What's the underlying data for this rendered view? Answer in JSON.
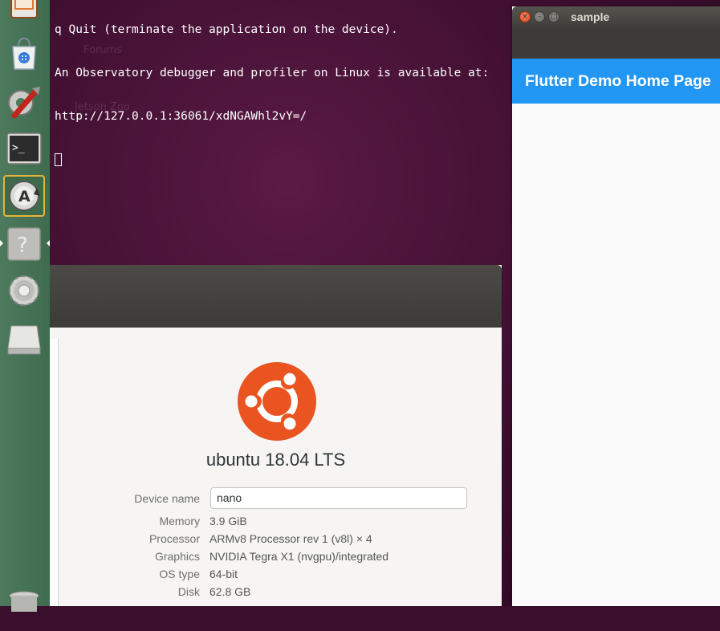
{
  "terminal": {
    "lines": [
      "q Quit (terminate the application on the device).",
      "An Observatory debugger and profiler on Linux is available at:",
      "http://127.0.0.1:36061/xdNGAWhl2vY=/"
    ]
  },
  "desktop": {
    "ghost_label_1": "Forums",
    "ghost_label_2": "Jetson Zoo"
  },
  "launcher": {
    "items": [
      {
        "name": "presentation-app-icon"
      },
      {
        "name": "software-center-icon"
      },
      {
        "name": "system-tools-icon"
      },
      {
        "name": "terminal-icon"
      },
      {
        "name": "software-updater-icon"
      },
      {
        "name": "help-icon"
      },
      {
        "name": "system-settings-icon"
      },
      {
        "name": "drive-icon"
      },
      {
        "name": "trash-icon"
      }
    ]
  },
  "flutter_window": {
    "title": "sample",
    "appbar_title": "Flutter Demo Home Page",
    "close_glyph": "×",
    "minimize_glyph": "–",
    "maximize_glyph": "□"
  },
  "details": {
    "os_name": "ubuntu 18.04 LTS",
    "device_name_label": "Device name",
    "device_name_value": "nano",
    "memory_label": "Memory",
    "memory_value": "3.9 GiB",
    "processor_label": "Processor",
    "processor_value": "ARMv8 Processor rev 1 (v8l) × 4",
    "graphics_label": "Graphics",
    "graphics_value": "NVIDIA Tegra X1 (nvgpu)/integrated",
    "os_type_label": "OS type",
    "os_type_value": "64-bit",
    "disk_label": "Disk",
    "disk_value": "62.8 GB"
  },
  "colors": {
    "flutter_appbar": "#2196f3",
    "ubuntu_orange": "#e95420",
    "terminal_bg": "#3b0d2e"
  }
}
